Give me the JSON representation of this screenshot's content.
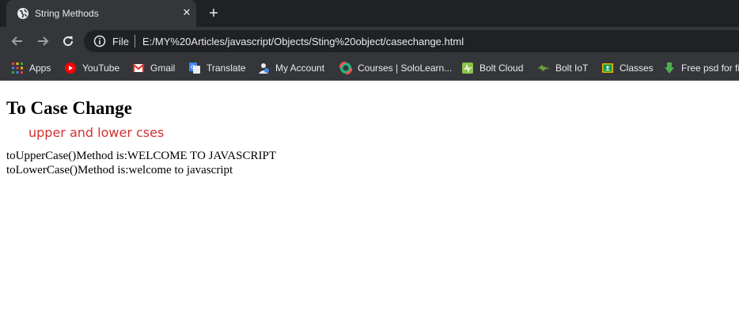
{
  "browser": {
    "tab": {
      "title": "String Methods",
      "close_glyph": "✕",
      "favicon": "globe-icon"
    },
    "new_tab_glyph": "+",
    "omnibox": {
      "scheme_label": "File",
      "url": "E:/MY%20Articles/javascript/Objects/Sting%20object/casechange.html"
    },
    "bookmarks": [
      {
        "label": "Apps",
        "icon": "apps-grid-icon"
      },
      {
        "label": "YouTube",
        "icon": "youtube-icon"
      },
      {
        "label": "Gmail",
        "icon": "gmail-icon"
      },
      {
        "label": "Translate",
        "icon": "translate-icon"
      },
      {
        "label": "My Account",
        "icon": "account-icon"
      },
      {
        "label": "Courses | SoloLearn...",
        "icon": "sololearn-icon"
      },
      {
        "label": "Bolt Cloud",
        "icon": "bolt-cloud-icon"
      },
      {
        "label": "Bolt IoT",
        "icon": "bolt-iot-icon"
      },
      {
        "label": "Classes",
        "icon": "classroom-icon"
      },
      {
        "label": "Free psd for fi",
        "icon": "download-arrow-icon"
      }
    ]
  },
  "page": {
    "title": "To Case Change",
    "subtitle": "upper and lower cses",
    "lines": [
      "toUpperCase()Method is:WELCOME TO JAVASCRIPT",
      "toLowerCase()Method is:welcome to javascript"
    ]
  },
  "colors": {
    "chrome_dark": "#202124",
    "chrome_toolbar": "#35363a",
    "subtitle_red": "#d32f2f"
  }
}
